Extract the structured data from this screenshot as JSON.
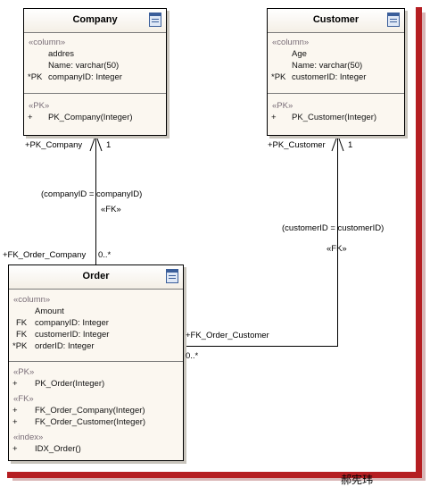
{
  "entities": {
    "company": {
      "title": "Company",
      "stereo_column": "«column»",
      "columns": [
        {
          "prefix": "",
          "text": "addres"
        },
        {
          "prefix": "",
          "text": "Name:  varchar(50)"
        },
        {
          "prefix": "*PK",
          "text": "companyID:  Integer"
        }
      ],
      "stereo_pk": "«PK»",
      "ops": [
        {
          "prefix": "+",
          "text": "PK_Company(Integer)"
        }
      ]
    },
    "customer": {
      "title": "Customer",
      "stereo_column": "«column»",
      "columns": [
        {
          "prefix": "",
          "text": "Age"
        },
        {
          "prefix": "",
          "text": "Name:  varchar(50)"
        },
        {
          "prefix": "*PK",
          "text": "customerID:  Integer"
        }
      ],
      "stereo_pk": "«PK»",
      "ops": [
        {
          "prefix": "+",
          "text": "PK_Customer(Integer)"
        }
      ]
    },
    "order": {
      "title": "Order",
      "stereo_column": "«column»",
      "columns": [
        {
          "prefix": "",
          "text": "Amount"
        },
        {
          "prefix": "FK",
          "text": "companyID:  Integer"
        },
        {
          "prefix": "FK",
          "text": "customerID:  Integer"
        },
        {
          "prefix": "*PK",
          "text": "orderID:  Integer"
        }
      ],
      "stereo_pk": "«PK»",
      "pk_ops": [
        {
          "prefix": "+",
          "text": "PK_Order(Integer)"
        }
      ],
      "stereo_fk": "«FK»",
      "fk_ops": [
        {
          "prefix": "+",
          "text": "FK_Order_Company(Integer)"
        },
        {
          "prefix": "+",
          "text": "FK_Order_Customer(Integer)"
        }
      ],
      "stereo_index": "«index»",
      "index_ops": [
        {
          "prefix": "+",
          "text": "IDX_Order()"
        }
      ]
    }
  },
  "links": {
    "company_order": {
      "role_target": "+PK_Company",
      "mult_target": "1",
      "condition": "(companyID = companyID)",
      "stereotype": "«FK»",
      "role_source": "+FK_Order_Company",
      "mult_source": "0..*"
    },
    "customer_order": {
      "role_target": "+PK_Customer",
      "mult_target": "1",
      "condition": "(customerID = customerID)",
      "stereotype": "«FK»",
      "role_source": "+FK_Order_Customer",
      "mult_source": "0..*"
    }
  },
  "watermark": "郝宪玮"
}
